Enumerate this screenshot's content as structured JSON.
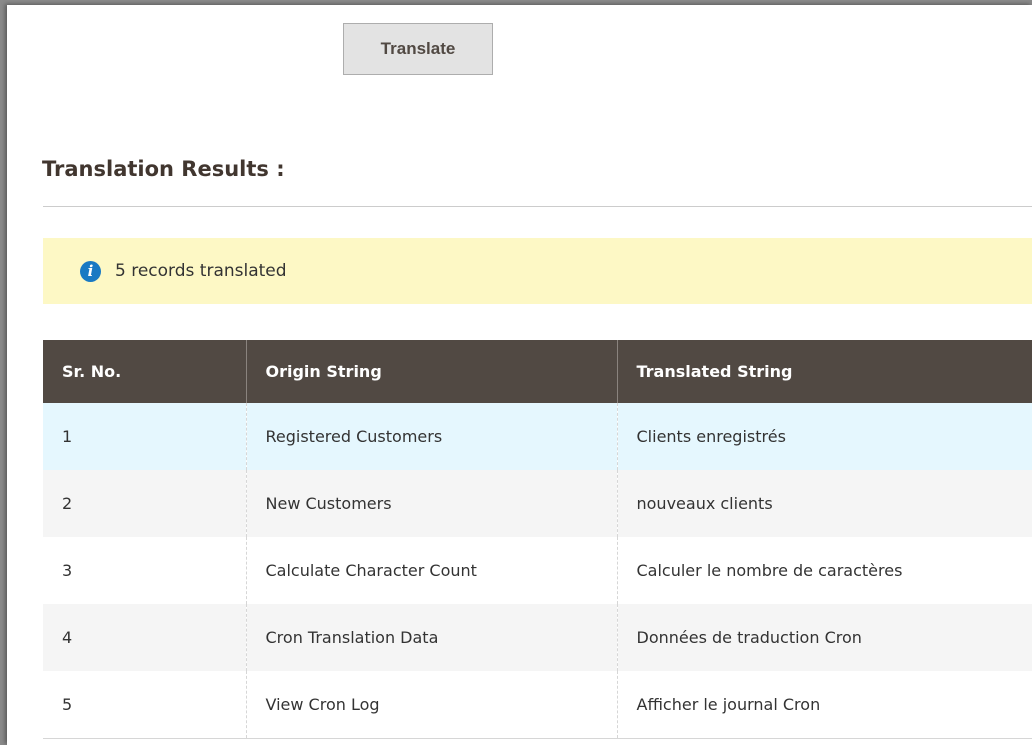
{
  "actions": {
    "translate_label": "Translate"
  },
  "results": {
    "title": "Translation Results :",
    "message": {
      "icon": "info-icon",
      "text": "5 records translated"
    },
    "table": {
      "columns": [
        "Sr. No.",
        "Origin String",
        "Translated String"
      ],
      "rows": [
        [
          "1",
          "Registered Customers",
          "Clients enregistrés"
        ],
        [
          "2",
          "New Customers",
          "nouveaux clients"
        ],
        [
          "3",
          "Calculate Character Count",
          "Calculer le nombre de caractères"
        ],
        [
          "4",
          "Cron Translation Data",
          "Données de traduction Cron"
        ],
        [
          "5",
          "View Cron Log",
          "Afficher le journal Cron"
        ]
      ]
    }
  },
  "colors": {
    "header_bg": "#514943",
    "message_bg": "#fdf8c5",
    "info_icon": "#1979c3",
    "highlight_row": "#e5f7fe"
  }
}
